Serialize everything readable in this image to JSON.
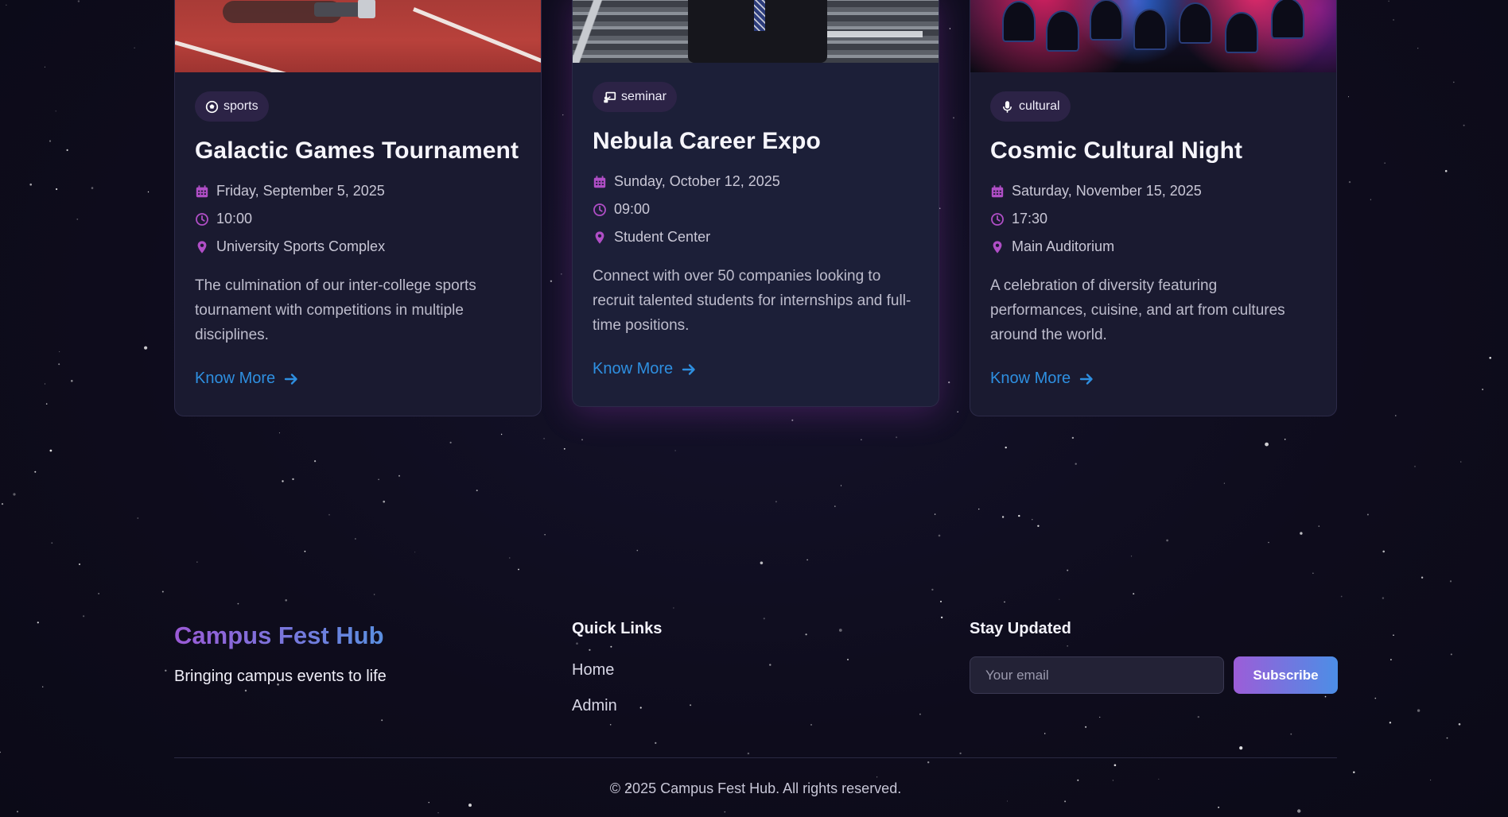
{
  "colors": {
    "background": "#0e0c1c",
    "card": "#1a1a30",
    "accent_link": "#2e8fe0",
    "icon_pink": "#b04ec6",
    "brand_gradient": [
      "#9b5ad6",
      "#5a8fe0"
    ]
  },
  "events": [
    {
      "category": "sports",
      "category_icon": "soccer-ball-icon",
      "title": "Galactic Games Tournament",
      "date": "Friday, September 5, 2025",
      "time": "10:00",
      "location": "University Sports Complex",
      "description": "The culmination of our inter-college sports tournament with competitions in multiple disciplines.",
      "cta": "Know More"
    },
    {
      "category": "seminar",
      "category_icon": "presentation-icon",
      "title": "Nebula Career Expo",
      "date": "Sunday, October 12, 2025",
      "time": "09:00",
      "location": "Student Center",
      "description": "Connect with over 50 companies looking to recruit talented students for internships and full-time positions.",
      "cta": "Know More"
    },
    {
      "category": "cultural",
      "category_icon": "microphone-icon",
      "title": "Cosmic Cultural Night",
      "date": "Saturday, November 15, 2025",
      "time": "17:30",
      "location": "Main Auditorium",
      "description": "A celebration of diversity featuring performances, cuisine, and art from cultures around the world.",
      "cta": "Know More"
    }
  ],
  "footer": {
    "brand": "Campus Fest Hub",
    "tagline": "Bringing campus events to life",
    "quick_links_title": "Quick Links",
    "quick_links": [
      "Home",
      "Admin"
    ],
    "stay_updated_title": "Stay Updated",
    "email_placeholder": "Your email",
    "subscribe_label": "Subscribe",
    "copyright": "© 2025 Campus Fest Hub. All rights reserved."
  }
}
